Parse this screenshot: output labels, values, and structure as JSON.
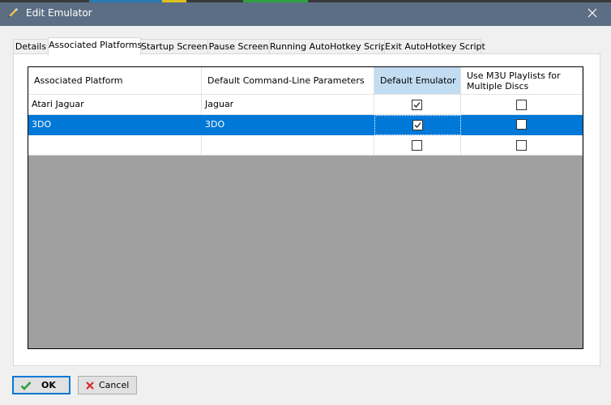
{
  "window": {
    "title": "Edit Emulator"
  },
  "tabs": [
    {
      "label": "Details"
    },
    {
      "label": "Associated Platforms"
    },
    {
      "label": "Startup Screen"
    },
    {
      "label": "Pause Screen"
    },
    {
      "label": "Running AutoHotkey Script"
    },
    {
      "label": "Exit AutoHotkey Script"
    }
  ],
  "active_tab": "Associated Platforms",
  "grid": {
    "columns": [
      {
        "label": "Associated Platform"
      },
      {
        "label": "Default Command-Line Parameters"
      },
      {
        "label": "Default Emulator"
      },
      {
        "label": "Use M3U Playlists for Multiple Discs"
      }
    ],
    "rows": [
      {
        "platform": "Atari Jaguar",
        "params": "Jaguar",
        "default_emulator": true,
        "m3u": false
      },
      {
        "platform": "3DO",
        "params": "3DO",
        "default_emulator": true,
        "m3u": false,
        "selected": true
      },
      {
        "platform": "",
        "params": "",
        "default_emulator": false,
        "m3u": false
      }
    ]
  },
  "buttons": {
    "ok": "OK",
    "cancel": "Cancel"
  },
  "colors": {
    "titlebar": "#5c6e84",
    "selection": "#0078d7",
    "header_selected": "#c2dcf2",
    "ok_icon": "#2ea043",
    "cancel_icon": "#d9252b"
  },
  "icons": {
    "title": "pencil-icon",
    "close": "close-icon",
    "ok": "checkmark-icon",
    "cancel": "x-icon"
  }
}
